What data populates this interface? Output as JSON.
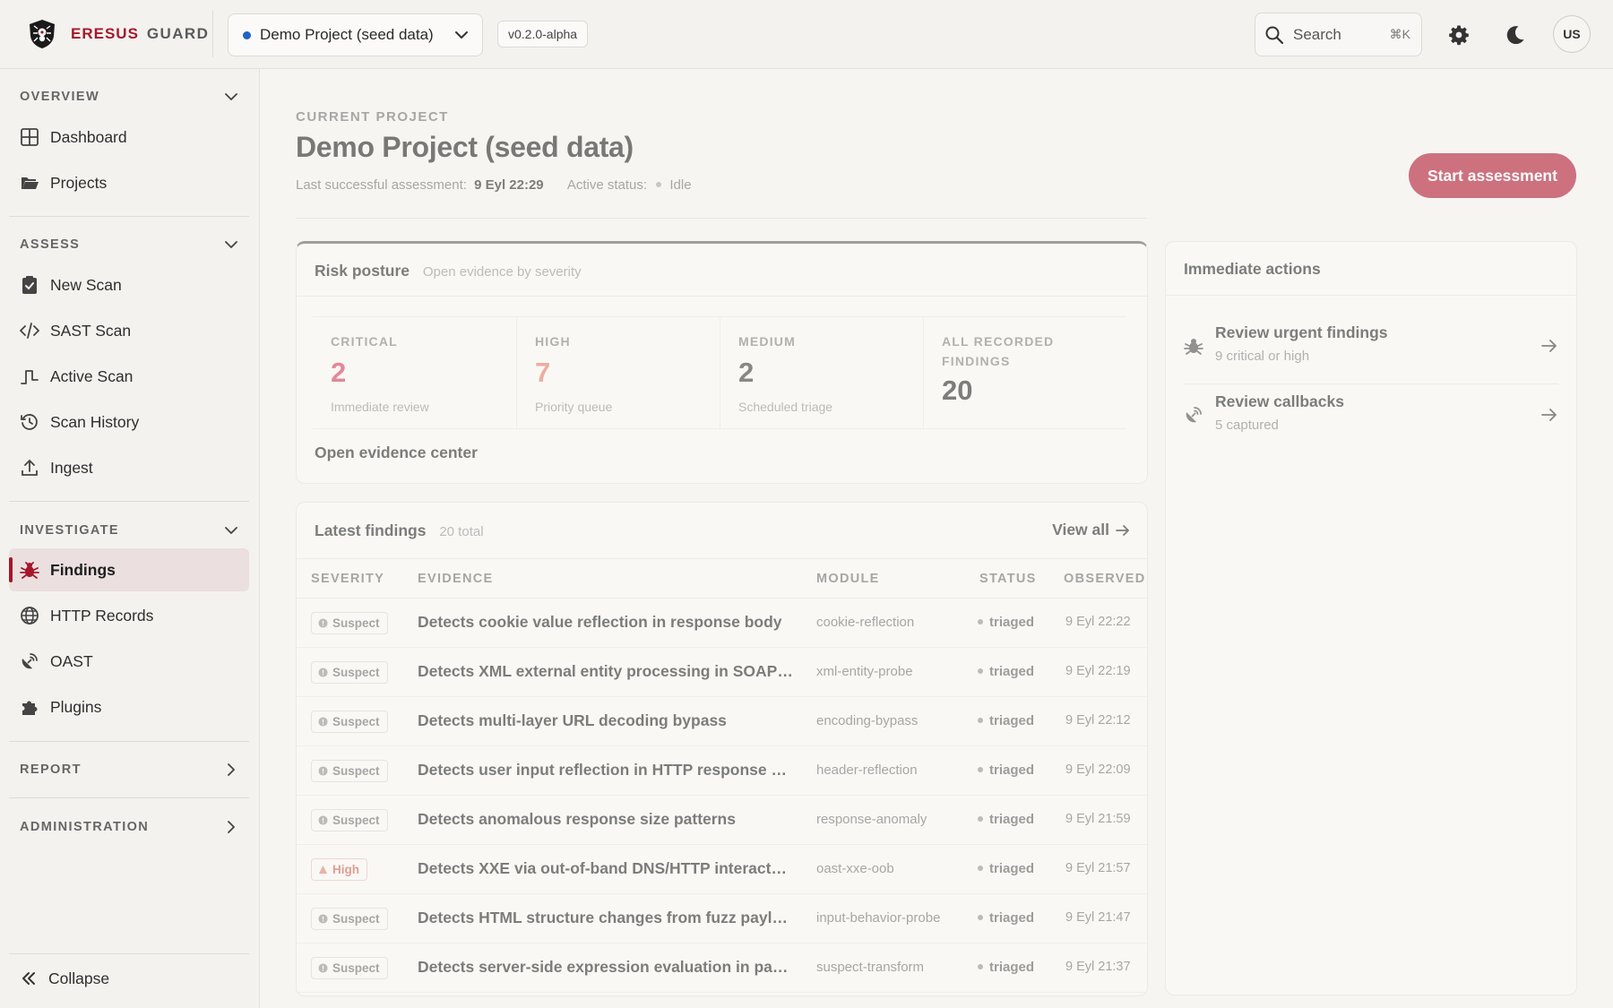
{
  "brand": {
    "primary": "ERESUS",
    "secondary": "GUARD"
  },
  "topbar": {
    "project": "Demo Project (seed data)",
    "version": "v0.2.0-alpha",
    "search_label": "Search",
    "search_shortcut": "⌘K",
    "avatar": "US"
  },
  "sidebar": {
    "sections": [
      {
        "title": "OVERVIEW",
        "expanded": true,
        "items": [
          {
            "label": "Dashboard",
            "icon": "grid-icon"
          },
          {
            "label": "Projects",
            "icon": "folder-icon"
          }
        ]
      },
      {
        "title": "ASSESS",
        "expanded": true,
        "items": [
          {
            "label": "New Scan",
            "icon": "clipboard-check-icon"
          },
          {
            "label": "SAST Scan",
            "icon": "code-icon"
          },
          {
            "label": "Active Scan",
            "icon": "pulse-icon"
          },
          {
            "label": "Scan History",
            "icon": "history-icon"
          },
          {
            "label": "Ingest",
            "icon": "upload-icon"
          }
        ]
      },
      {
        "title": "INVESTIGATE",
        "expanded": true,
        "items": [
          {
            "label": "Findings",
            "icon": "bug-icon",
            "active": true
          },
          {
            "label": "HTTP Records",
            "icon": "globe-icon"
          },
          {
            "label": "OAST",
            "icon": "satellite-icon"
          },
          {
            "label": "Plugins",
            "icon": "puzzle-icon"
          }
        ]
      },
      {
        "title": "REPORT",
        "expanded": false
      },
      {
        "title": "ADMINISTRATION",
        "expanded": false
      }
    ],
    "collapse_label": "Collapse"
  },
  "main": {
    "eyebrow": "CURRENT PROJECT",
    "title": "Demo Project (seed data)",
    "last_label": "Last successful assessment:",
    "last_value": "9 Eyl 22:29",
    "status_label": "Active status:",
    "status_value": "Idle",
    "start_button": "Start assessment"
  },
  "risk": {
    "title": "Risk posture",
    "subtitle": "Open evidence by severity",
    "stats": [
      {
        "label": "CRITICAL",
        "value": "2",
        "note": "Immediate review",
        "color": "#d9485f"
      },
      {
        "label": "HIGH",
        "value": "7",
        "note": "Priority queue",
        "color": "#e8826e"
      },
      {
        "label": "MEDIUM",
        "value": "2",
        "note": "Scheduled triage",
        "color": "#444444"
      },
      {
        "label": "ALL RECORDED FINDINGS",
        "value": "20",
        "note": "",
        "color": "#333333"
      }
    ],
    "link": "Open evidence center"
  },
  "actions": {
    "title": "Immediate actions",
    "items": [
      {
        "title": "Review urgent findings",
        "subtitle": "9 critical or high",
        "icon": "bug-icon"
      },
      {
        "title": "Review callbacks",
        "subtitle": "5 captured",
        "icon": "satellite-icon"
      }
    ]
  },
  "findings": {
    "title": "Latest findings",
    "count": "20 total",
    "view_all": "View all",
    "columns": [
      "SEVERITY",
      "EVIDENCE",
      "MODULE",
      "STATUS",
      "OBSERVED"
    ],
    "rows": [
      {
        "severity": "Suspect",
        "evidence": "Detects cookie value reflection in response body",
        "module": "cookie-reflection",
        "status": "triaged",
        "time": "9 Eyl 22:22"
      },
      {
        "severity": "Suspect",
        "evidence": "Detects XML external entity processing in SOAP…",
        "module": "xml-entity-probe",
        "status": "triaged",
        "time": "9 Eyl 22:19"
      },
      {
        "severity": "Suspect",
        "evidence": "Detects multi-layer URL decoding bypass",
        "module": "encoding-bypass",
        "status": "triaged",
        "time": "9 Eyl 22:12"
      },
      {
        "severity": "Suspect",
        "evidence": "Detects user input reflection in HTTP response h…",
        "module": "header-reflection",
        "status": "triaged",
        "time": "9 Eyl 22:09"
      },
      {
        "severity": "Suspect",
        "evidence": "Detects anomalous response size patterns",
        "module": "response-anomaly",
        "status": "triaged",
        "time": "9 Eyl 21:59"
      },
      {
        "severity": "High",
        "evidence": "Detects XXE via out-of-band DNS/HTTP interact…",
        "module": "oast-xxe-oob",
        "status": "triaged",
        "time": "9 Eyl 21:57"
      },
      {
        "severity": "Suspect",
        "evidence": "Detects HTML structure changes from fuzz payl…",
        "module": "input-behavior-probe",
        "status": "triaged",
        "time": "9 Eyl 21:47"
      },
      {
        "severity": "Suspect",
        "evidence": "Detects server-side expression evaluation in par…",
        "module": "suspect-transform",
        "status": "triaged",
        "time": "9 Eyl 21:37"
      }
    ]
  }
}
